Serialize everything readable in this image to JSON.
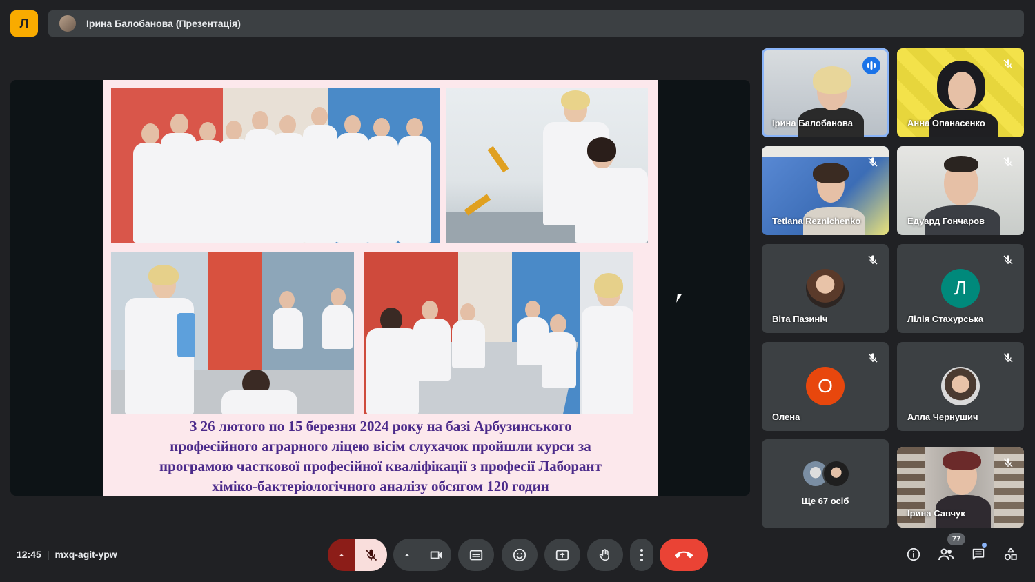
{
  "app": {
    "logo_glyph": "Л",
    "accent_color": "#f9ab00"
  },
  "header": {
    "presenter_title": "Ірина Балобанова (Презентація)"
  },
  "slide": {
    "caption_lines": [
      "З 26 лютого по 15 березня 2024 року на базі Арбузинського",
      "професійного аграрного ліцею вісім слухачок пройшли курси за",
      "програмою часткової професійної кваліфікації з професії Лаборант",
      "хіміко-бактеріологічного аналізу обсягом 120 годин"
    ]
  },
  "participants": [
    {
      "name": "Ірина Балобанова",
      "state": "speaking"
    },
    {
      "name": "Анна Опанасенко",
      "state": "muted"
    },
    {
      "name": "Tetiana Reznichenko",
      "state": "muted"
    },
    {
      "name": "Едуард Гончаров",
      "state": "muted"
    },
    {
      "name": "Віта Пазиніч",
      "state": "muted"
    },
    {
      "name": "Лілія Стахурська",
      "state": "muted",
      "initial": "Л",
      "avatar_color": "#00897b"
    },
    {
      "name": "Олена",
      "state": "muted",
      "initial": "О",
      "avatar_color": "#e8470d"
    },
    {
      "name": "Алла Чернушич",
      "state": "muted"
    },
    {
      "more_label": "Ще 67 осіб"
    },
    {
      "name": "Ірина Савчук",
      "state": "muted"
    }
  ],
  "footer": {
    "time": "12:45",
    "meeting_code": "mxq-agit-ypw",
    "participants_count": "77",
    "leave_color": "#ea4335"
  }
}
